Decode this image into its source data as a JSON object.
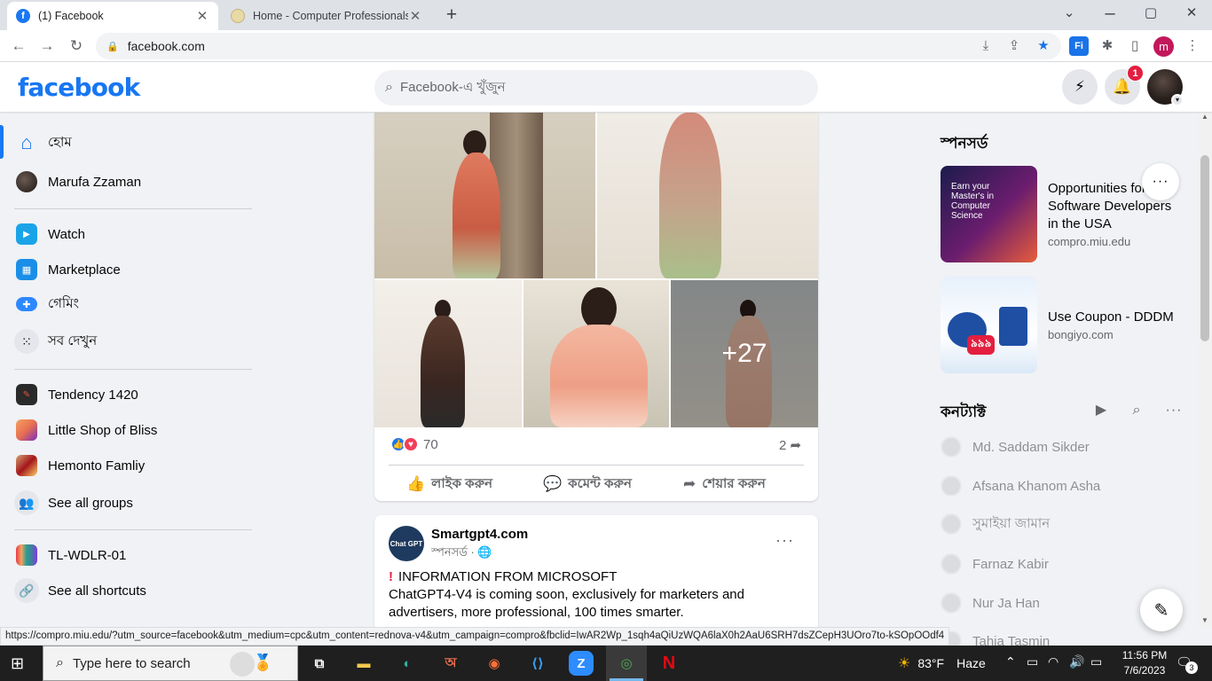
{
  "browser": {
    "tabs": [
      {
        "title": "(1) Facebook",
        "close": "✕",
        "favicon": "facebook-icon"
      },
      {
        "title": "Home - Computer Professionals",
        "close": "✕",
        "favicon": "miu-icon"
      }
    ],
    "new_tab": "+",
    "window_controls": {
      "minimize": "⌄",
      "restore": "▢",
      "close": "✕"
    },
    "url": "facebook.com",
    "status_url": "https://compro.miu.edu/?utm_source=facebook&utm_medium=cpc&utm_content=rednova-v4&utm_campaign=compro&fbclid=IwAR2Wp_1sqh4aQiUzWQA6laX0h2AaU6SRH7dsZCepH3UOro7to-kSOpOOdf4",
    "profile_initial": "m",
    "extension_fi": "Fi"
  },
  "header": {
    "logo": "facebook",
    "search_placeholder": "Facebook-এ খুঁজুন",
    "notification_count": "1"
  },
  "sidebar": {
    "items": [
      {
        "label": "হোম",
        "icon": "home-icon"
      },
      {
        "label": "Marufa Zzaman",
        "icon": "avatar"
      },
      {
        "label": "Watch",
        "icon": "watch-icon"
      },
      {
        "label": "Marketplace",
        "icon": "marketplace-icon"
      },
      {
        "label": "গেমিং",
        "icon": "gaming-icon"
      },
      {
        "label": "সব দেখুন",
        "icon": "grid-icon"
      },
      {
        "label": "Tendency 1420",
        "icon": "group-avatar"
      },
      {
        "label": "Little Shop of Bliss",
        "icon": "group-avatar"
      },
      {
        "label": "Hemonto Famliy",
        "icon": "group-avatar"
      },
      {
        "label": "See all groups",
        "icon": "groups-icon"
      },
      {
        "label": "TL-WDLR-01",
        "icon": "shortcut-avatar"
      },
      {
        "label": "See all shortcuts",
        "icon": "link-icon"
      }
    ]
  },
  "feed": {
    "photo_post": {
      "more_photos": "+27",
      "reaction_count": "70",
      "share_count": "2",
      "like_label": "লাইক করুন",
      "comment_label": "কমেন্ট করুন",
      "share_label": "শেয়ার করুন"
    },
    "sponsored_post": {
      "avatar_text": "Chat GPT",
      "page_name": "Smartgpt4.com",
      "sponsored_label": "স্পনসর্ড · ",
      "headline": "INFORMATION FROM MICROSOFT",
      "body": "ChatGPT4-V4 is coming soon, exclusively for marketers and advertisers, more professional, 100 times smarter.",
      "more": "···"
    }
  },
  "right_rail": {
    "sponsored_title": "স্পনসর্ড",
    "ads": [
      {
        "title": "Opportunities for Software Developers in the USA",
        "domain": "compro.miu.edu",
        "img_text": "Earn your Master's in Computer Science"
      },
      {
        "title": "Use Coupon - DDDM",
        "domain": "bongiyo.com",
        "img_text": "৯৯৯"
      }
    ],
    "ad_more": "···",
    "contacts_title": "কনট্যাক্ট",
    "contacts": [
      "Md. Saddam Sikder",
      "Afsana Khanom Asha",
      "সুমাইয়া জামান",
      "Farnaz Kabir",
      "Nur Ja Han",
      "Tahia Tasmin"
    ]
  },
  "taskbar": {
    "search_placeholder": "Type here to search",
    "weather_temp": "83°F",
    "weather_desc": "Haze",
    "time": "11:56 PM",
    "date": "7/6/2023",
    "notification_count": "3"
  },
  "colors": {
    "fb_blue": "#1877f2",
    "notif_red": "#e41e3f",
    "bg_gray": "#f0f2f5"
  }
}
